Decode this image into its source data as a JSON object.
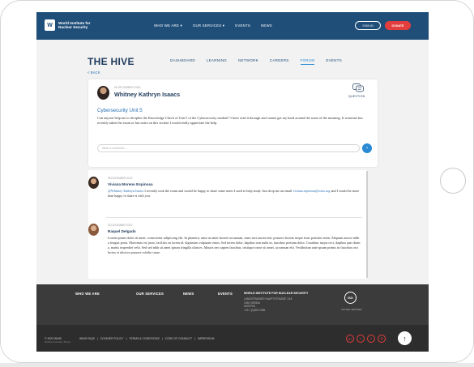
{
  "topnav": {
    "logo_line1": "World Institute for",
    "logo_line2": "Nuclear Security",
    "links": [
      "WHO WE ARE ▾",
      "OUR SERVICES ▾",
      "EVENTS",
      "NEWS"
    ],
    "signin": "SIGN IN",
    "donate": "DONATE"
  },
  "hive": {
    "title": "THE HIVE",
    "tabs": [
      "DASHBOARD",
      "LEARNING",
      "NETWORK",
      "CAREERS",
      "FORUM",
      "EVENTS"
    ],
    "active_tab": "FORUM",
    "back": "< BACK"
  },
  "question": {
    "date": "05 DECEMBER 2022",
    "author": "Whitney Kathryn Isaacs",
    "type": "QUESTION",
    "title": "Cybersecurity Unit 5",
    "body": "Can anyone help me to decipher the Knowledge Check of Unit 5 of the Cybersecurity module? I have read it through and cannot get my head around the some of the meaning. If someone has recently taken the exam or has notes on this section I would really appreciate the help.",
    "reply_placeholder": "Write a comment..."
  },
  "answers": [
    {
      "date": "05 DECEMBER 2022",
      "author": "Viviana Moreno Espinosa",
      "mention": "@Whitney Kathryn Isaacs",
      "body_a": " I recently took the exam and would be happy to share some notes I used to help study. Just drop me an email ",
      "email": "viviana.espinosa@wins.org",
      "body_b": " and I would be more than happy to share it with you."
    },
    {
      "date": "05 DECEMBER 2022",
      "author": "Raquel Delgado",
      "body": "Lorem ipsum dolor sit amet, consectetur adipiscing elit. In pharetra, urna sit amet laoreet accumsan, nunc nisi auctor nisl, posuere lacinia neque risus porttitor enim. Aliquam auctor nibh a feugiat porta. Maecenas est justo, facilisis eu lorem id, dignissim vulputate enim. Sed lorem dolor, dapibus non nulla in, faucibus pretium dolor. Curabitur turpis orci, dapibus quis diam a, mattis imperdiet velit. Sed sed nibh sit amet ipsum fringilla ultrices. Mauris nec sapien faucibus, tristique tortor sit amet, accumsan elit. Vestibulum ante ipsum primis in faucibus orci luctus et ultrices posuere cubilia curae."
    }
  ],
  "footer": {
    "columns": [
      "WHO WE ARE",
      "OUR SERVICES",
      "NEWS",
      "EVENTS"
    ],
    "org": "WORLD INSTITUTE FOR NUCLEAR SECURITY",
    "address": [
      "LANDSTRASSER HAUPTSTRASSE 1/18",
      "1030 VIENNA",
      "AUSTRIA",
      "+43 1 (0)000 2365"
    ],
    "iso": "ISO",
    "iso_sub": "ISO 9001 CERTIFIED",
    "copyright": "© 2022 WINS",
    "copy_sub": "Website by Reside | Privacy",
    "legal": [
      "WINS FAQS",
      "|",
      "COOKIES POLICY",
      "|",
      "TERMS & CONDITIONS",
      "|",
      "CODE OF CONDUCT",
      "|",
      "IMPRESSUM"
    ],
    "social": [
      "in",
      "t",
      "f",
      "◎"
    ],
    "to_top": "↑"
  },
  "colors": {
    "navy": "#1f4e79",
    "accent_blue": "#2a8bd4",
    "donate_red": "#e43d3d",
    "footer": "#3b3b3b"
  }
}
